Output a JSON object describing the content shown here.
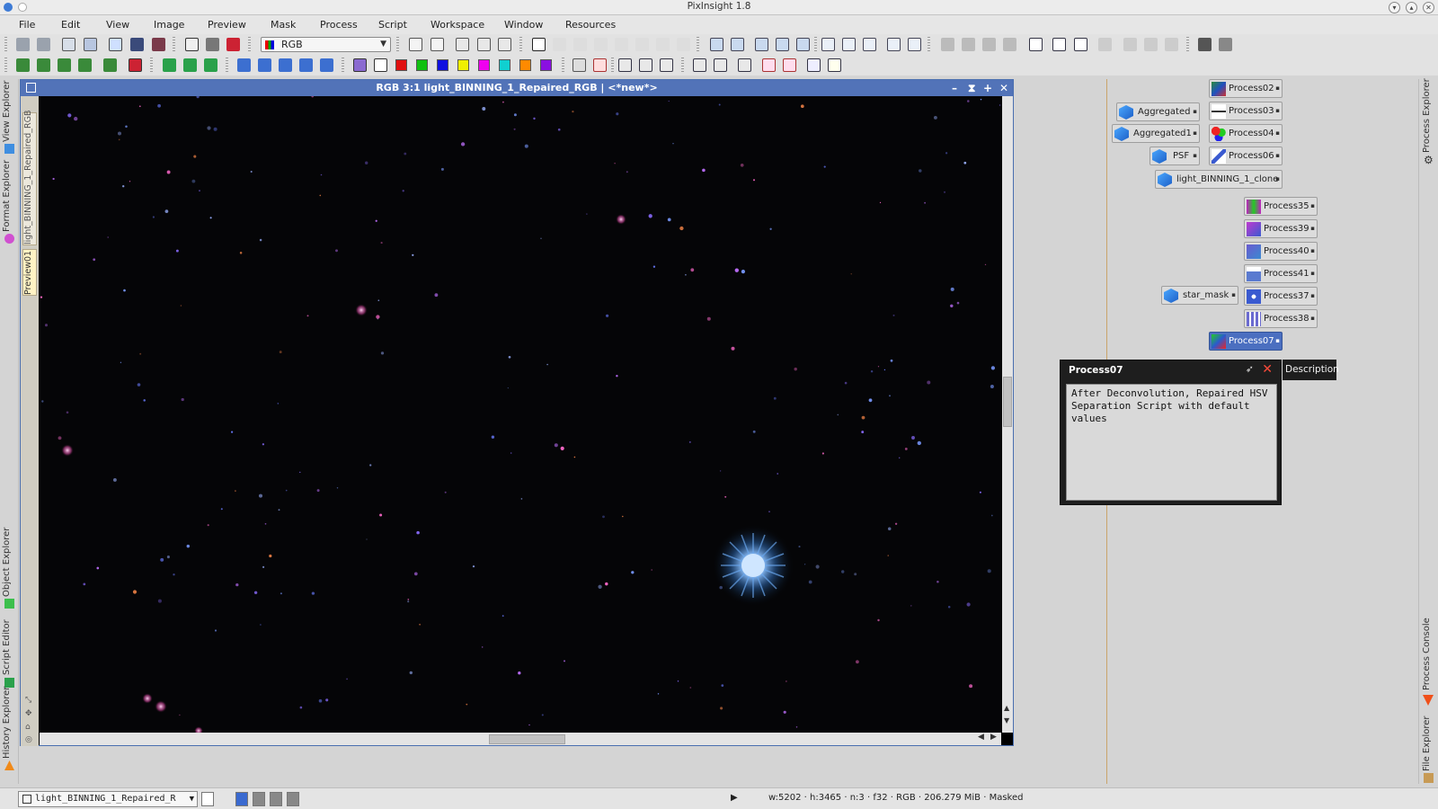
{
  "app": {
    "title": "PixInsight 1.8"
  },
  "menu": [
    "File",
    "Edit",
    "View",
    "Image",
    "Preview",
    "Mask",
    "Process",
    "Script",
    "Workspace",
    "Window",
    "Resources"
  ],
  "toolbar": {
    "channel_select": "RGB"
  },
  "image_window": {
    "title": "RGB 3:1 light_BINNING_1_Repaired_RGB | <*new*>",
    "side_tabs": [
      "light_BINNING_1_Repaired_RGB",
      "Preview01"
    ]
  },
  "left_dock": [
    "View Explorer",
    "Format Explorer",
    "Object Explorer",
    "Script Editor",
    "History Explorer"
  ],
  "right_dock": [
    "Process Explorer",
    "Process Console",
    "File Explorer"
  ],
  "process_icons": [
    {
      "label": "Process02"
    },
    {
      "label": "Process03"
    },
    {
      "label": "Process04"
    },
    {
      "label": "Process06"
    },
    {
      "label": "Process35"
    },
    {
      "label": "Process39"
    },
    {
      "label": "Process40"
    },
    {
      "label": "Process41"
    },
    {
      "label": "Process37"
    },
    {
      "label": "Process38"
    },
    {
      "label": "Process07"
    }
  ],
  "image_icons": [
    {
      "label": "Aggregated"
    },
    {
      "label": "Aggregated1"
    },
    {
      "label": "PSF"
    },
    {
      "label": "light_BINNING_1_clone"
    },
    {
      "label": "star_mask"
    }
  ],
  "description_popup": {
    "title": "Process07",
    "text": "After Deconvolution, Repaired HSV Separation Script with default values",
    "tab_label": "Description"
  },
  "statusbar": {
    "view": "light_BINNING_1_Repaired_R",
    "width": "w:5202",
    "height": "h:3465",
    "channels": "n:3",
    "sample_format": "f32",
    "color_space": "RGB",
    "memory": "206.279 MiB",
    "mask_state": "Masked"
  }
}
